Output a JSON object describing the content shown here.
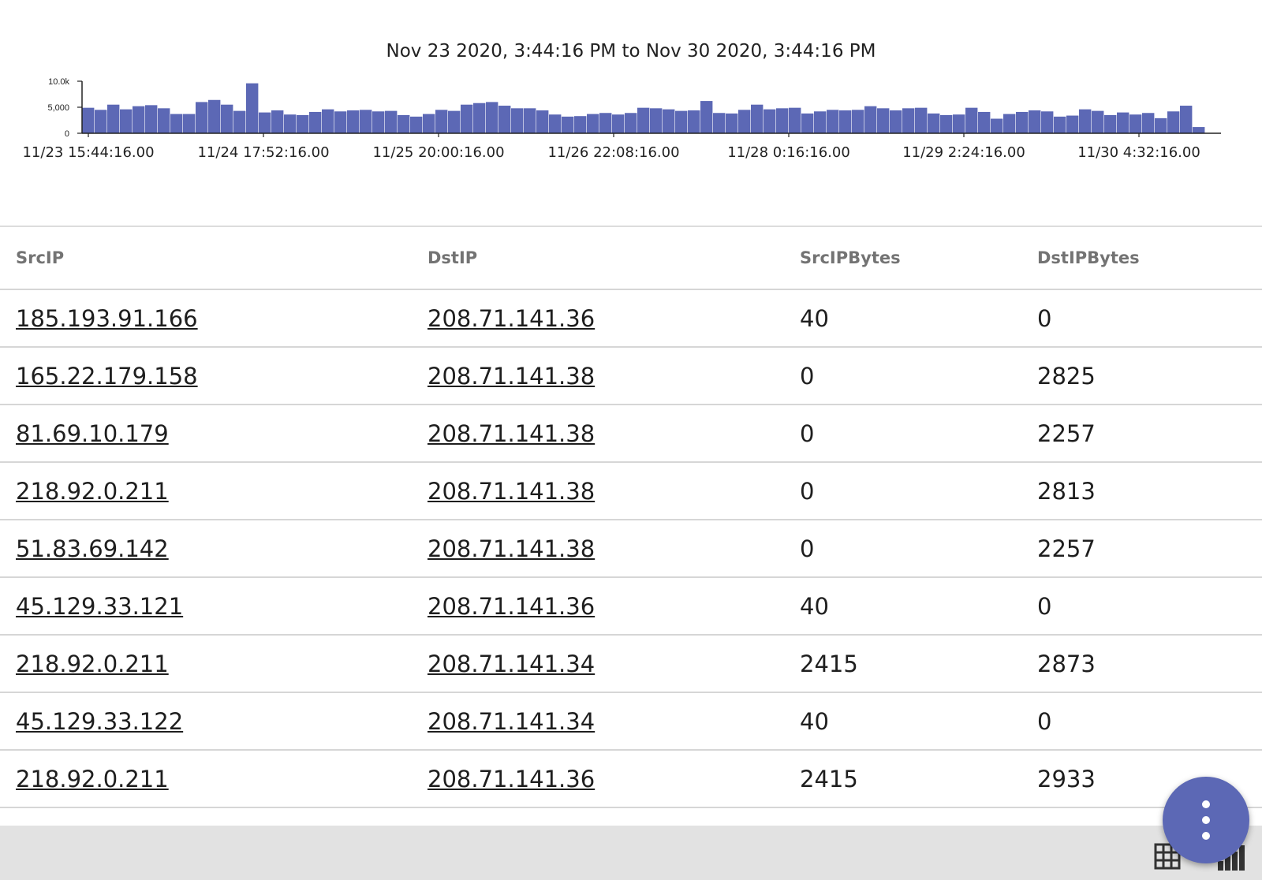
{
  "chart": {
    "range_title": "Nov 23 2020, 3:44:16 PM to Nov 30 2020, 3:44:16 PM"
  },
  "chart_data": {
    "type": "bar",
    "title": "",
    "xlabel": "",
    "ylabel": "",
    "ylim": [
      0,
      10000
    ],
    "y_ticks": [
      "10.0k",
      "5,000",
      "0"
    ],
    "y_tick_values": [
      10000,
      5000,
      0
    ],
    "x_tick_labels": [
      "11/23 15:44:16.00",
      "11/24 17:52:16.00",
      "11/25 20:00:16.00",
      "11/26 22:08:16.00",
      "11/28 0:16:16.00",
      "11/29 2:24:16.00",
      "11/30 4:32:16.00"
    ],
    "bar_color": "#5c68b5",
    "grid": false,
    "values": [
      4900,
      4500,
      5500,
      4600,
      5200,
      5400,
      4800,
      3700,
      3700,
      6000,
      6400,
      5500,
      4300,
      9600,
      4000,
      4400,
      3600,
      3500,
      4100,
      4600,
      4200,
      4400,
      4500,
      4200,
      4300,
      3500,
      3200,
      3700,
      4500,
      4300,
      5500,
      5800,
      6000,
      5300,
      4800,
      4800,
      4400,
      3600,
      3200,
      3300,
      3700,
      3900,
      3600,
      3900,
      4900,
      4800,
      4600,
      4300,
      4400,
      6200,
      3900,
      3800,
      4500,
      5500,
      4600,
      4800,
      4900,
      3800,
      4200,
      4500,
      4400,
      4500,
      5200,
      4800,
      4400,
      4800,
      4900,
      3800,
      3500,
      3600,
      4900,
      4100,
      2800,
      3700,
      4100,
      4400,
      4200,
      3200,
      3400,
      4600,
      4300,
      3500,
      4000,
      3600,
      3900,
      2900,
      4200,
      5300,
      1200
    ]
  },
  "table": {
    "columns": [
      "SrcIP",
      "DstIP",
      "SrcIPBytes",
      "DstIPBytes"
    ],
    "rows": [
      [
        "185.193.91.166",
        "208.71.141.36",
        "40",
        "0"
      ],
      [
        "165.22.179.158",
        "208.71.141.38",
        "0",
        "2825"
      ],
      [
        "81.69.10.179",
        "208.71.141.38",
        "0",
        "2257"
      ],
      [
        "218.92.0.211",
        "208.71.141.38",
        "0",
        "2813"
      ],
      [
        "51.83.69.142",
        "208.71.141.38",
        "0",
        "2257"
      ],
      [
        "45.129.33.121",
        "208.71.141.36",
        "40",
        "0"
      ],
      [
        "218.92.0.211",
        "208.71.141.34",
        "2415",
        "2873"
      ],
      [
        "45.129.33.122",
        "208.71.141.34",
        "40",
        "0"
      ],
      [
        "218.92.0.211",
        "208.71.141.36",
        "2415",
        "2933"
      ],
      [
        "",
        "",
        "",
        ""
      ]
    ]
  },
  "toolbar": {
    "grid_icon": "table-grid-icon",
    "chart_icon": "bar-chart-icon",
    "fab_icon": "more-vert-icon",
    "fab_color": "#5c68b5"
  }
}
